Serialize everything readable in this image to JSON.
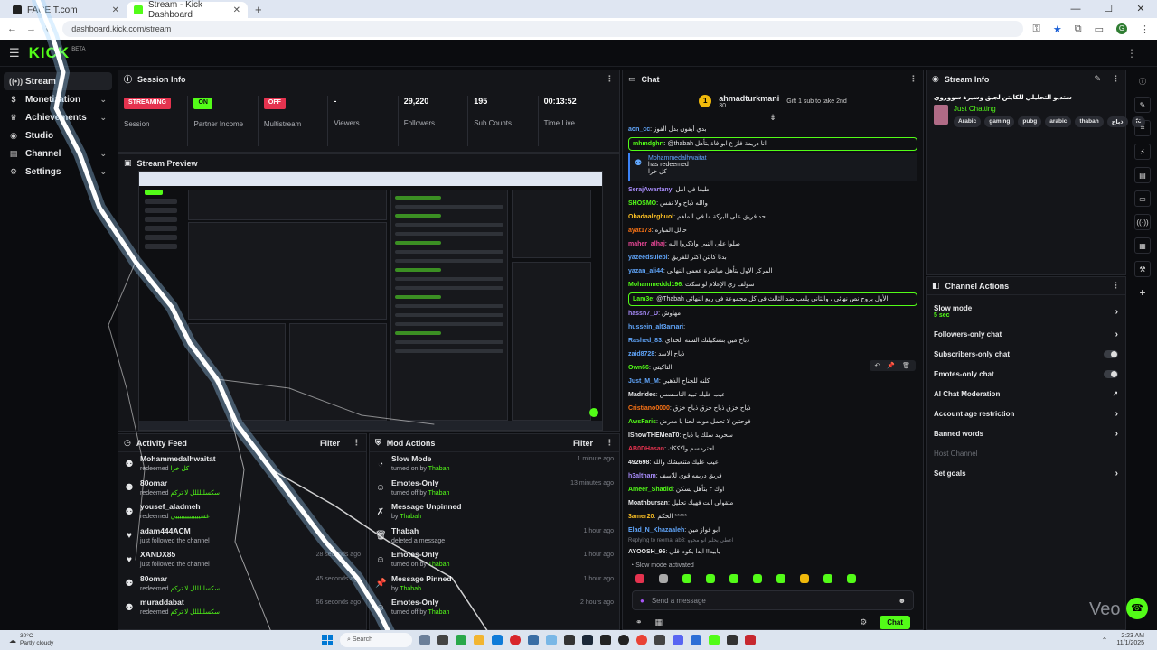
{
  "browser": {
    "tabs": [
      {
        "label": "FACEIT.com",
        "active": false
      },
      {
        "label": "Stream - Kick Dashboard",
        "active": true
      }
    ],
    "url": "dashboard.kick.com/stream",
    "new_tab": "+",
    "profile_initial": "G"
  },
  "brand": {
    "logo": "KICK",
    "beta": "BETA",
    "accent": "#53fc18"
  },
  "sidebar": {
    "items": [
      {
        "label": "Stream",
        "icon": "stream-icon",
        "active": true,
        "expandable": false
      },
      {
        "label": "Monetization",
        "icon": "dollar-icon",
        "active": false,
        "expandable": true
      },
      {
        "label": "Achievements",
        "icon": "trophy-icon",
        "active": false,
        "expandable": true
      },
      {
        "label": "Studio",
        "icon": "studio-icon",
        "active": false,
        "expandable": false
      },
      {
        "label": "Channel",
        "icon": "channel-icon",
        "active": false,
        "expandable": true
      },
      {
        "label": "Settings",
        "icon": "gear-icon",
        "active": false,
        "expandable": true
      }
    ]
  },
  "session": {
    "title": "Session Info",
    "stats": [
      {
        "value": "STREAMING",
        "label": "Session",
        "badge": "red"
      },
      {
        "value": "ON",
        "label": "Partner Income",
        "badge": "green"
      },
      {
        "value": "OFF",
        "label": "Multistream",
        "badge": "red"
      },
      {
        "value": "-",
        "label": "Viewers",
        "badge": ""
      },
      {
        "value": "29,220",
        "label": "Followers",
        "badge": ""
      },
      {
        "value": "195",
        "label": "Sub Counts",
        "badge": ""
      },
      {
        "value": "00:13:52",
        "label": "Time Live",
        "badge": ""
      }
    ]
  },
  "preview": {
    "title": "Stream Preview"
  },
  "activity": {
    "title": "Activity Feed",
    "filter": "Filter",
    "items": [
      {
        "name": "Mohammedalhwaitat",
        "sub": "redeemed",
        "hl": "كل خرا",
        "time": "",
        "icon": "redeem-icon"
      },
      {
        "name": "80omar",
        "sub": "redeemed",
        "hl": "سكسلللللل لا تركم",
        "time": "",
        "icon": "redeem-icon"
      },
      {
        "name": "yousef_aladmeh",
        "sub": "redeemed",
        "hl": "غسيييييييييييييي",
        "time": "",
        "icon": "redeem-icon"
      },
      {
        "name": "adam444ACM",
        "sub": "just followed the channel",
        "hl": "",
        "time": "",
        "icon": "heart-icon"
      },
      {
        "name": "XANDX85",
        "sub": "just followed the channel",
        "hl": "",
        "time": "28 seconds ago",
        "icon": "heart-icon"
      },
      {
        "name": "80omar",
        "sub": "redeemed",
        "hl": "سكسلللللل لا تركم",
        "time": "45 seconds ago",
        "icon": "redeem-icon"
      },
      {
        "name": "muraddabat",
        "sub": "redeemed",
        "hl": "سكسلللللل لا تركم",
        "time": "56 seconds ago",
        "icon": "redeem-icon"
      }
    ]
  },
  "modactions": {
    "title": "Mod Actions",
    "filter": "Filter",
    "items": [
      {
        "name": "Slow Mode",
        "sub": "turned on by",
        "by": "Thabah",
        "time": "1 minute ago",
        "icon": "clock-icon"
      },
      {
        "name": "Emotes-Only",
        "sub": "turned off by",
        "by": "Thabah",
        "time": "13 minutes ago",
        "icon": "emote-icon"
      },
      {
        "name": "Message Unpinned",
        "sub": "by",
        "by": "Thabah",
        "time": "",
        "icon": "unpin-icon"
      },
      {
        "name": "Thabah",
        "sub": "deleted a message",
        "by": "",
        "time": "1 hour ago",
        "icon": "trash-icon"
      },
      {
        "name": "Emotes-Only",
        "sub": "turned on by",
        "by": "Thabah",
        "time": "1 hour ago",
        "icon": "emote-icon"
      },
      {
        "name": "Message Pinned",
        "sub": "by",
        "by": "Thabah",
        "time": "1 hour ago",
        "icon": "pin-icon"
      },
      {
        "name": "Emotes-Only",
        "sub": "turned off by",
        "by": "Thabah",
        "time": "2 hours ago",
        "icon": "emote-icon"
      }
    ]
  },
  "chat": {
    "title": "Chat",
    "pinned": {
      "user": "ahmadturkmani",
      "count": "30",
      "gift": "Gift 1 sub to take 2nd"
    },
    "messages": [
      {
        "user": "aon_cc",
        "color": "#60a5fa",
        "text": "بدي أيفون بدل الفوز",
        "box": false
      },
      {
        "user": "mhmdghrt",
        "color": "#53fc18",
        "text": "@thabah انا دريمة فاز ع ابو فاة بتأهل",
        "box": true
      }
    ],
    "redeem": {
      "user": "Mohammedalhwaitat",
      "action": "has redeemed",
      "reward": "كل خرا"
    },
    "messages2": [
      {
        "user": "SerajAwartany",
        "color": "#a78bfa",
        "text": "طبعا في امل",
        "box": false
      },
      {
        "user": "SHOSMO",
        "color": "#53fc18",
        "text": "والله ذباح ولا نفس",
        "box": false
      },
      {
        "user": "Obadaalzghuol",
        "color": "#fbbf24",
        "text": "حد فريق على البركة ما في الماهم",
        "box": false
      },
      {
        "user": "ayat173",
        "color": "#f97316",
        "text": "حالل المباره",
        "box": false
      },
      {
        "user": "maher_alhaj",
        "color": "#ec4899",
        "text": "صلوا على النبي واذكروا الله",
        "box": false
      },
      {
        "user": "yazeedsulebi",
        "color": "#60a5fa",
        "text": "بدنا كابتن اكثر للفريق",
        "box": false
      },
      {
        "user": "yazan_ali44",
        "color": "#60a5fa",
        "text": "المركز الاول بتأهل مباشرة ععمى النهائي",
        "box": false
      },
      {
        "user": "Mohammeddd196",
        "color": "#53fc18",
        "text": "سولف زي الإعلام لو سكت",
        "box": false
      },
      {
        "user": "Lam3e",
        "color": "#53fc18",
        "text": "@Thabah الأول بروح نص نهائي ، والثاني يلعب ضد الثالث في كل مجموعة في ربع النهائي",
        "box": true
      },
      {
        "user": "hassn7_D",
        "color": "#a78bfa",
        "text": "مهاوش",
        "box": false
      },
      {
        "user": "hussein_alt3amari",
        "color": "#60a5fa",
        "text": "",
        "box": false
      },
      {
        "user": "Rashed_83",
        "color": "#60a5fa",
        "text": "ذباح مين بتشكيلتك السته الحذاي",
        "box": false
      },
      {
        "user": "zaid8728",
        "color": "#60a5fa",
        "text": "ذباح الاسد",
        "box": false
      },
      {
        "user": "Own66",
        "color": "#53fc18",
        "text": "التاكيتي",
        "box": false
      },
      {
        "user": "Just_M_M",
        "color": "#60a5fa",
        "text": "كلنه للجناح الذهبي",
        "box": false
      },
      {
        "user": "Madrides",
        "color": "#e7e8ea",
        "text": "عيب عليك تبيد الناسسس",
        "box": false
      },
      {
        "user": "Cristiano0000",
        "color": "#f97316",
        "text": "ذباح خزق ذباح خزق ذباح خزق",
        "box": false
      },
      {
        "user": "AwsFaris",
        "color": "#53fc18",
        "text": "فوحتين لا تحمل موت لحنا يا معرض",
        "box": false
      },
      {
        "user": "IShowTHEMeaT0",
        "color": "#e7e8ea",
        "text": "سحريد سلك يا ذباح",
        "box": false
      },
      {
        "user": "AB0DHasan",
        "color": "#e5334f",
        "text": "احترمسم واكككك",
        "box": false
      },
      {
        "user": "492698",
        "color": "#e7e8ea",
        "text": "عيب عليك متنعبشك والله",
        "box": false
      },
      {
        "user": "h3altham",
        "color": "#a78bfa",
        "text": "فريق دريمه قوي للاسف",
        "box": false
      },
      {
        "user": "Ameer_Shadid",
        "color": "#53fc18",
        "text": "اوك ٢ بتأهل يسكن",
        "box": false
      },
      {
        "user": "Moathbursan",
        "color": "#e7e8ea",
        "text": "متقولي انت فهيك تحليل",
        "box": false
      },
      {
        "user": "3amer20",
        "color": "#fbbf24",
        "text": "الحكم *****",
        "box": false
      },
      {
        "user": "Elad_N_Khazaaleh",
        "color": "#60a5fa",
        "text": "ابو فواز مين",
        "box": false
      }
    ],
    "reply_note": "Replying to reema_ab3: اعطي بحلم انو محوو",
    "last_msg": {
      "user": "AYOOSH_96",
      "color": "#e7e8ea",
      "text": "يابيه!! ابدا بكوم قلي"
    },
    "slow_mode_note": "Slow mode activated",
    "input_placeholder": "Send a message",
    "send_button": "Chat"
  },
  "streaminfo": {
    "title": "Stream Info",
    "stream_title": "ستديو التحليلي للكابتن لجيق وسيرة سووروي",
    "category": "Just Chatting",
    "tags": [
      "Arabic",
      "gaming",
      "pubg",
      "arabic",
      "thabah",
      "ذباح",
      "fc"
    ]
  },
  "channelactions": {
    "title": "Channel Actions",
    "items": [
      {
        "label": "Slow mode",
        "sub": "5 sec",
        "control": "chevron",
        "disabled": false
      },
      {
        "label": "Followers-only chat",
        "sub": "",
        "control": "chevron",
        "disabled": false
      },
      {
        "label": "Subscribers-only chat",
        "sub": "",
        "control": "toggle",
        "disabled": false
      },
      {
        "label": "Emotes-only chat",
        "sub": "",
        "control": "toggle",
        "disabled": false
      },
      {
        "label": "AI Chat Moderation",
        "sub": "",
        "control": "external",
        "disabled": false
      },
      {
        "label": "Account age restriction",
        "sub": "",
        "control": "chevron",
        "disabled": false
      },
      {
        "label": "Banned words",
        "sub": "",
        "control": "chevron",
        "disabled": false
      },
      {
        "label": "Host Channel",
        "sub": "",
        "control": "",
        "disabled": true
      },
      {
        "label": "Set goals",
        "sub": "",
        "control": "chevron",
        "disabled": false
      }
    ]
  },
  "watermark": "Veo",
  "taskbar": {
    "temp": "30°C",
    "weather": "Partly cloudy",
    "search": "Search",
    "time": "2:23 AM",
    "date": "11/1/2025"
  }
}
